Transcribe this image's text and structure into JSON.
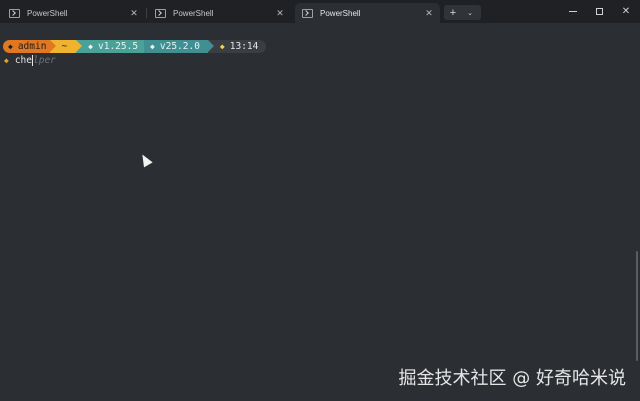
{
  "tabs": [
    {
      "label": "PowerShell",
      "active": false
    },
    {
      "label": "PowerShell",
      "active": false
    },
    {
      "label": "PowerShell",
      "active": true
    }
  ],
  "tab_close_glyph": "✕",
  "new_tab_glyph": "+",
  "dropdown_glyph": "⌄",
  "window_controls": {
    "close_glyph": "✕"
  },
  "prompt": {
    "user": "admin",
    "path": "~",
    "version_1": "v1.25.5",
    "version_2": "v25.2.0",
    "time": "13:14",
    "segment_glyph": "◆",
    "colors": {
      "user": "#e27721",
      "path": "#efb330",
      "versions": "#4aa197",
      "time": "#3a3d42"
    }
  },
  "input": {
    "prompt_glyph": "◆",
    "typed": "che",
    "suggestion": "lper"
  },
  "watermark": "掘金技术社区 @ 好奇哈米说",
  "background_color": "#2b2e33"
}
